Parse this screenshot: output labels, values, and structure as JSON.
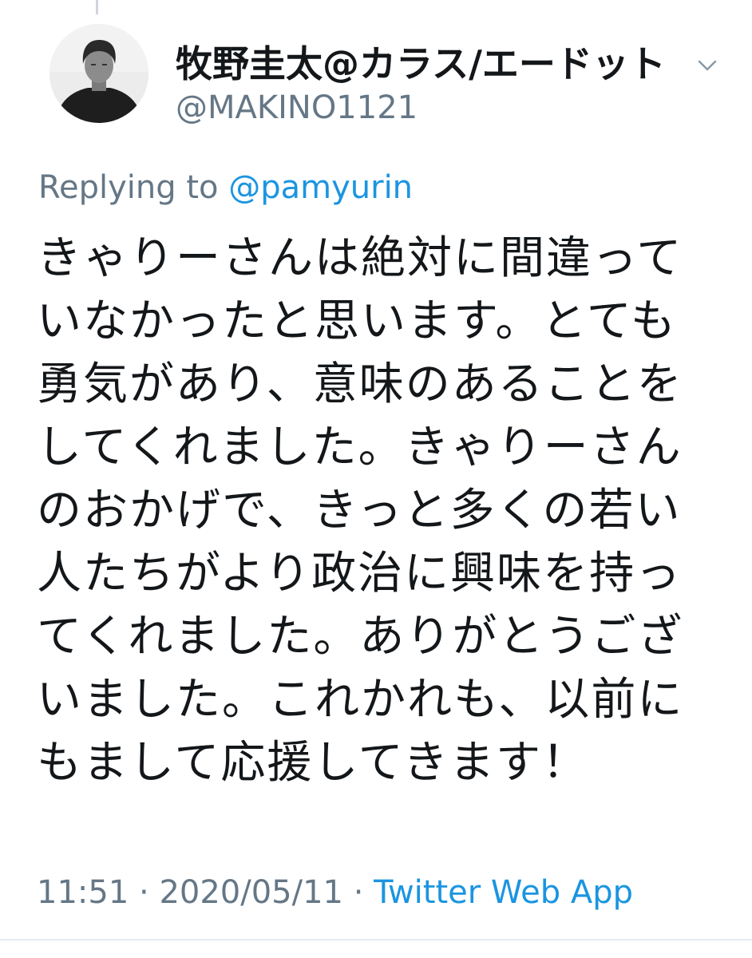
{
  "tweet": {
    "display_name": "牧野圭太@カラス/エードット",
    "handle": "@MAKINO1121",
    "replying_prefix": "Replying to",
    "replying_to": "@pamyurin",
    "lines": [
      "きゃりーさんは絶対に間違って",
      "いなかったと思います。とても",
      "勇気があり、意味のあることを",
      "してくれました。きゃりーさん",
      "のおかげで、きっと多くの若い",
      "人たちがより政治に興味を持っ",
      "てくれました。ありがとうござ",
      "いました。これかれも、以前に",
      "もまして応援してきます！"
    ],
    "time": "11:51",
    "separator": "·",
    "date": "2020/05/11",
    "source": "Twitter Web App"
  },
  "icons": {
    "avatar": "avatar-photo",
    "menu": "chevron-down-icon"
  },
  "colors": {
    "text": "#14171a",
    "secondary": "#657786",
    "link": "#1b95e0",
    "background": "#ffffff"
  }
}
